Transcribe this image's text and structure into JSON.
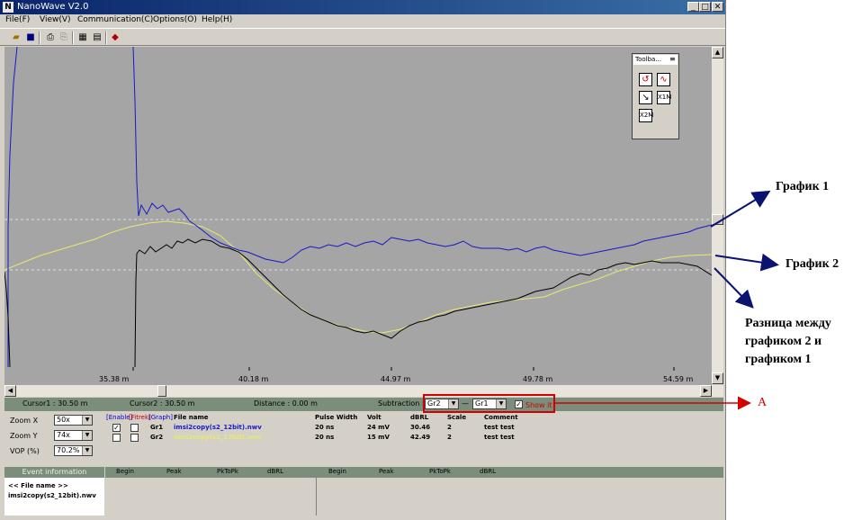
{
  "window": {
    "title": "NanoWave V2.0",
    "app_icon": "N",
    "min_glyph": "_",
    "max_glyph": "□",
    "close_glyph": "✕"
  },
  "menu": {
    "file": "File(F)",
    "view": "View(V)",
    "communication": "Communication(C)",
    "options": "Options(O)",
    "help": "Help(H)"
  },
  "toolbox": {
    "title": "Toolba...",
    "btn_x1m": "X1M",
    "btn_x2m": "X2M"
  },
  "plot": {
    "x_ticks": [
      "35.38 m",
      "40.18 m",
      "44.97 m",
      "49.78 m",
      "54.59 m"
    ],
    "colors": {
      "graph1": "#1818c8",
      "graph2": "#e8e870",
      "diff": "#000000",
      "dashed": "#e0e0e0"
    }
  },
  "cursor_bar": {
    "cursor1": "Cursor1 :  30.50 m",
    "cursor2": "Cursor2 :  30.50 m",
    "distance": "Distance :  0.00 m",
    "subtraction": "Subtraction :",
    "minuend": "Gr2",
    "dash": "—",
    "subtrahend": "Gr1",
    "show_it": "Show it"
  },
  "zoom": {
    "zoom_x_label": "Zoom X",
    "zoom_x_value": "50x",
    "zoom_y_label": "Zoom Y",
    "zoom_y_value": "74x",
    "vop_label": "VOP (%)",
    "vop_value": "70.2%"
  },
  "files_table": {
    "col_enable": "[Enable]",
    "col_fitrek": "[Fitrek]",
    "col_graph": "[Graph]",
    "col_file_name": "File name",
    "col_pulse": "Pulse Width",
    "col_volt": "Volt",
    "col_dbrl": "dBRL",
    "col_scale": "Scale",
    "col_comment": "Comment",
    "rows": [
      {
        "graph": "Gr1",
        "file": "imsi2copy(s2_12bit).nwv",
        "pulse": "20 ns",
        "volt": "24 mV",
        "dbrl": "30.46",
        "scale": "2",
        "comment": "test test",
        "enabled": "✓"
      },
      {
        "graph": "Gr2",
        "file": "imsi2copy(s2_12bit).nwv",
        "pulse": "20 ns",
        "volt": "15 mV",
        "dbrl": "42.49",
        "scale": "2",
        "comment": "test test",
        "enabled": ""
      }
    ],
    "row_colors": [
      "#1818c8",
      "#e8e870"
    ]
  },
  "events": {
    "header": "Event information",
    "col_begin": "Begin",
    "col_peak": "Peak",
    "col_pktopk": "PkToPk",
    "col_dbrl": "dBRL",
    "col_begin2": "Begin",
    "col_peak2": "Peak",
    "col_pktopk2": "PkToPk",
    "col_dbrl2": "dBRL",
    "file_label": "<< File name >>",
    "file_value": "imsi2copy(s2_12bit).nwv"
  },
  "annotations": {
    "graph1": "График 1",
    "graph2": "График 2",
    "diff_line1": "Разница между",
    "diff_line2": "графиком 2 и",
    "diff_line3": "графиком 1",
    "marker": "A"
  }
}
